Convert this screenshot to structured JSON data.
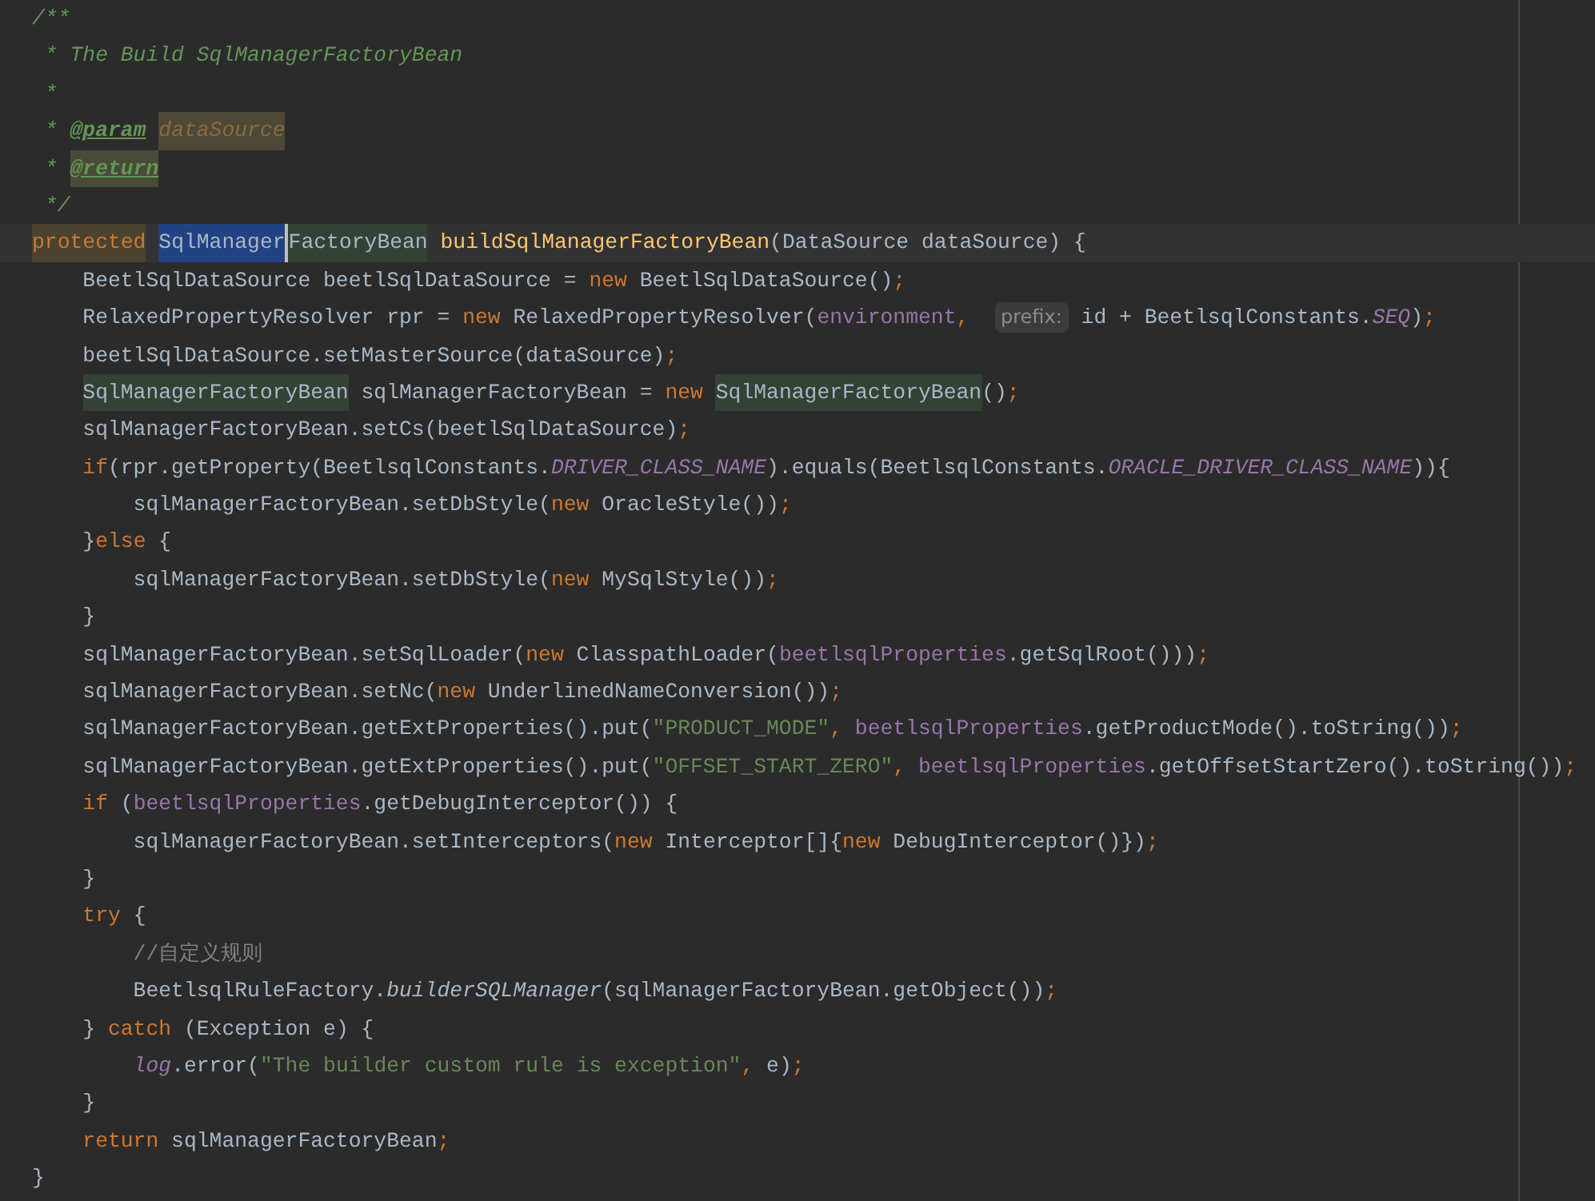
{
  "editor": {
    "lines": [
      {
        "current": false,
        "tokens": [
          {
            "kind": "doc",
            "text": "/**"
          }
        ]
      },
      {
        "current": false,
        "tokens": [
          {
            "kind": "doc",
            "text": " * The Build SqlManagerFactoryBean"
          }
        ]
      },
      {
        "current": false,
        "tokens": [
          {
            "kind": "doc",
            "text": " *"
          }
        ]
      },
      {
        "current": false,
        "tokens": [
          {
            "kind": "doc",
            "text": " * "
          },
          {
            "kind": "doc-tag",
            "text": "@param"
          },
          {
            "kind": "doc-ref",
            "text": " dataSource"
          }
        ]
      },
      {
        "current": false,
        "tokens": [
          {
            "kind": "doc",
            "text": " * "
          },
          {
            "kind": "doc-tag-marked",
            "text": "@return"
          }
        ]
      },
      {
        "current": false,
        "tokens": [
          {
            "kind": "doc",
            "text": " */"
          }
        ]
      },
      {
        "current": true,
        "tokens": [
          {
            "kind": "keyword-marked",
            "text": "protected"
          },
          {
            "kind": "selected",
            "text": " SqlManager"
          },
          {
            "kind": "usage",
            "text": "FactoryBean"
          },
          {
            "kind": "decl",
            "text": " buildSqlManagerFactoryBean"
          },
          {
            "kind": "plain",
            "text": "(DataSource dataSource) {"
          }
        ]
      },
      {
        "current": false,
        "tokens": [
          {
            "kind": "plain",
            "text": "    BeetlSqlDataSource beetlSqlDataSource = "
          },
          {
            "kind": "keyword",
            "text": "new"
          },
          {
            "kind": "plain",
            "text": " BeetlSqlDataSource()"
          },
          {
            "kind": "punct",
            "text": ";"
          }
        ]
      },
      {
        "current": false,
        "tokens": [
          {
            "kind": "plain",
            "text": "    RelaxedPropertyResolver rpr = "
          },
          {
            "kind": "keyword",
            "text": "new"
          },
          {
            "kind": "plain",
            "text": " RelaxedPropertyResolver("
          },
          {
            "kind": "field",
            "text": "environment"
          },
          {
            "kind": "punct",
            "text": ","
          },
          {
            "kind": "hint",
            "text": "  prefix:"
          },
          {
            "kind": "plain",
            "text": " id + BeetlsqlConstants."
          },
          {
            "kind": "static",
            "text": "SEQ"
          },
          {
            "kind": "plain",
            "text": ")"
          },
          {
            "kind": "punct",
            "text": ";"
          }
        ]
      },
      {
        "current": false,
        "tokens": [
          {
            "kind": "plain",
            "text": "    beetlSqlDataSource.setMasterSource(dataSource)"
          },
          {
            "kind": "punct",
            "text": ";"
          }
        ]
      },
      {
        "current": false,
        "tokens": [
          {
            "kind": "usage",
            "text": "    SqlManagerFactoryBean"
          },
          {
            "kind": "plain",
            "text": " sqlManagerFactoryBean = "
          },
          {
            "kind": "keyword",
            "text": "new"
          },
          {
            "kind": "usage",
            "text": " SqlManagerFactoryBean"
          },
          {
            "kind": "plain",
            "text": "()"
          },
          {
            "kind": "punct",
            "text": ";"
          }
        ]
      },
      {
        "current": false,
        "tokens": [
          {
            "kind": "plain",
            "text": "    sqlManagerFactoryBean.setCs(beetlSqlDataSource)"
          },
          {
            "kind": "punct",
            "text": ";"
          }
        ]
      },
      {
        "current": false,
        "tokens": [
          {
            "kind": "keyword",
            "text": "    if"
          },
          {
            "kind": "plain",
            "text": "(rpr.getProperty(BeetlsqlConstants."
          },
          {
            "kind": "static",
            "text": "DRIVER_CLASS_NAME"
          },
          {
            "kind": "plain",
            "text": ").equals(BeetlsqlConstants."
          },
          {
            "kind": "static",
            "text": "ORACLE_DRIVER_CLASS_NAME"
          },
          {
            "kind": "plain",
            "text": ")){"
          }
        ]
      },
      {
        "current": false,
        "tokens": [
          {
            "kind": "plain",
            "text": "        sqlManagerFactoryBean.setDbStyle("
          },
          {
            "kind": "keyword",
            "text": "new"
          },
          {
            "kind": "plain",
            "text": " OracleStyle())"
          },
          {
            "kind": "punct",
            "text": ";"
          }
        ]
      },
      {
        "current": false,
        "tokens": [
          {
            "kind": "plain",
            "text": "    }"
          },
          {
            "kind": "keyword",
            "text": "else"
          },
          {
            "kind": "plain",
            "text": " {"
          }
        ]
      },
      {
        "current": false,
        "tokens": [
          {
            "kind": "plain",
            "text": "        sqlManagerFactoryBean.setDbStyle("
          },
          {
            "kind": "keyword",
            "text": "new"
          },
          {
            "kind": "plain",
            "text": " MySqlStyle())"
          },
          {
            "kind": "punct",
            "text": ";"
          }
        ]
      },
      {
        "current": false,
        "tokens": [
          {
            "kind": "plain",
            "text": "    }"
          }
        ]
      },
      {
        "current": false,
        "tokens": [
          {
            "kind": "plain",
            "text": "    sqlManagerFactoryBean.setSqlLoader("
          },
          {
            "kind": "keyword",
            "text": "new"
          },
          {
            "kind": "plain",
            "text": " ClasspathLoader("
          },
          {
            "kind": "field",
            "text": "beetlsqlProperties"
          },
          {
            "kind": "plain",
            "text": ".getSqlRoot()))"
          },
          {
            "kind": "punct",
            "text": ";"
          }
        ]
      },
      {
        "current": false,
        "tokens": [
          {
            "kind": "plain",
            "text": "    sqlManagerFactoryBean.setNc("
          },
          {
            "kind": "keyword",
            "text": "new"
          },
          {
            "kind": "plain",
            "text": " UnderlinedNameConversion())"
          },
          {
            "kind": "punct",
            "text": ";"
          }
        ]
      },
      {
        "current": false,
        "tokens": [
          {
            "kind": "plain",
            "text": "    sqlManagerFactoryBean.getExtProperties().put("
          },
          {
            "kind": "string",
            "text": "\"PRODUCT_MODE\""
          },
          {
            "kind": "punct",
            "text": ","
          },
          {
            "kind": "field",
            "text": " beetlsqlProperties"
          },
          {
            "kind": "plain",
            "text": ".getProductMode().toString())"
          },
          {
            "kind": "punct",
            "text": ";"
          }
        ]
      },
      {
        "current": false,
        "tokens": [
          {
            "kind": "plain",
            "text": "    sqlManagerFactoryBean.getExtProperties().put("
          },
          {
            "kind": "string",
            "text": "\"OFFSET_START_ZERO\""
          },
          {
            "kind": "punct",
            "text": ","
          },
          {
            "kind": "field",
            "text": " beetlsqlProperties"
          },
          {
            "kind": "plain",
            "text": ".getOffsetStartZero().toString())"
          },
          {
            "kind": "punct",
            "text": ";"
          }
        ]
      },
      {
        "current": false,
        "tokens": [
          {
            "kind": "keyword",
            "text": "    if"
          },
          {
            "kind": "plain",
            "text": " ("
          },
          {
            "kind": "field",
            "text": "beetlsqlProperties"
          },
          {
            "kind": "plain",
            "text": ".getDebugInterceptor()) {"
          }
        ]
      },
      {
        "current": false,
        "tokens": [
          {
            "kind": "plain",
            "text": "        sqlManagerFactoryBean.setInterceptors("
          },
          {
            "kind": "keyword",
            "text": "new"
          },
          {
            "kind": "plain",
            "text": " Interceptor[]{"
          },
          {
            "kind": "keyword",
            "text": "new"
          },
          {
            "kind": "plain",
            "text": " DebugInterceptor()})"
          },
          {
            "kind": "punct",
            "text": ";"
          }
        ]
      },
      {
        "current": false,
        "tokens": [
          {
            "kind": "plain",
            "text": "    }"
          }
        ]
      },
      {
        "current": false,
        "tokens": [
          {
            "kind": "keyword",
            "text": "    try"
          },
          {
            "kind": "plain",
            "text": " {"
          }
        ]
      },
      {
        "current": false,
        "tokens": [
          {
            "kind": "comment",
            "text": "        //自定义规则"
          }
        ]
      },
      {
        "current": false,
        "tokens": [
          {
            "kind": "plain",
            "text": "        BeetlsqlRuleFactory."
          },
          {
            "kind": "static-call",
            "text": "builderSQLManager"
          },
          {
            "kind": "plain",
            "text": "(sqlManagerFactoryBean.getObject())"
          },
          {
            "kind": "punct",
            "text": ";"
          }
        ]
      },
      {
        "current": false,
        "tokens": [
          {
            "kind": "plain",
            "text": "    } "
          },
          {
            "kind": "keyword",
            "text": "catch"
          },
          {
            "kind": "plain",
            "text": " (Exception e) {"
          }
        ]
      },
      {
        "current": false,
        "tokens": [
          {
            "kind": "static",
            "text": "        log"
          },
          {
            "kind": "plain",
            "text": ".error("
          },
          {
            "kind": "string",
            "text": "\"The builder custom rule is exception\""
          },
          {
            "kind": "punct",
            "text": ","
          },
          {
            "kind": "plain",
            "text": " e)"
          },
          {
            "kind": "punct",
            "text": ";"
          }
        ]
      },
      {
        "current": false,
        "tokens": [
          {
            "kind": "plain",
            "text": "    }"
          }
        ]
      },
      {
        "current": false,
        "tokens": [
          {
            "kind": "keyword",
            "text": "    return"
          },
          {
            "kind": "plain",
            "text": " sqlManagerFactoryBean"
          },
          {
            "kind": "punct",
            "text": ";"
          }
        ]
      },
      {
        "current": false,
        "tokens": [
          {
            "kind": "plain",
            "text": "}"
          }
        ]
      }
    ]
  }
}
